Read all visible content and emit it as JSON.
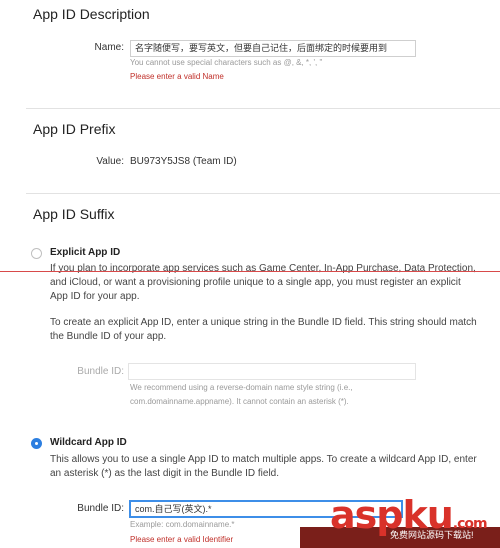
{
  "description": {
    "title": "App ID Description",
    "name_label": "Name:",
    "name_value": "名字随便写，要写英文，但要自己记住，后面绑定的时候要用到",
    "name_hint": "You cannot use special characters such as @, &, *, ', \"",
    "name_error": "Please enter a valid Name"
  },
  "prefix": {
    "title": "App ID Prefix",
    "value_label": "Value:",
    "value": "BU973Y5JS8 (Team ID)"
  },
  "suffix": {
    "title": "App ID Suffix",
    "explicit": {
      "title": "Explicit App ID",
      "checked": false,
      "para1": "If you plan to incorporate app services such as Game Center, In-App Purchase, Data Protection, and iCloud, or want a provisioning profile unique to a single app, you must register an explicit App ID for your app.",
      "para2": "To create an explicit App ID, enter a unique string in the Bundle ID field. This string should match the Bundle ID of your app.",
      "bundle_label": "Bundle ID:",
      "bundle_value": "",
      "bundle_hint": "We recommend using a reverse-domain name style string (i.e., com.domainname.appname). It cannot contain an asterisk (*)."
    },
    "wildcard": {
      "title": "Wildcard App ID",
      "checked": true,
      "para1": "This allows you to use a single App ID to match multiple apps. To create a wildcard App ID, enter an asterisk (*) as the last digit in the Bundle ID field.",
      "bundle_label": "Bundle ID:",
      "bundle_value": "com.自己写(英文).*",
      "bundle_hint": "Example: com.domainname.*",
      "bundle_error": "Please enter a valid Identifier"
    }
  },
  "watermark": {
    "logo": "aspku",
    "logo_suffix": ".com",
    "subtitle": "免费网站源码下载站!"
  },
  "colors": {
    "accent": "#2d7fe0",
    "error": "#c0302a",
    "watermark_red": "#d9322a"
  }
}
